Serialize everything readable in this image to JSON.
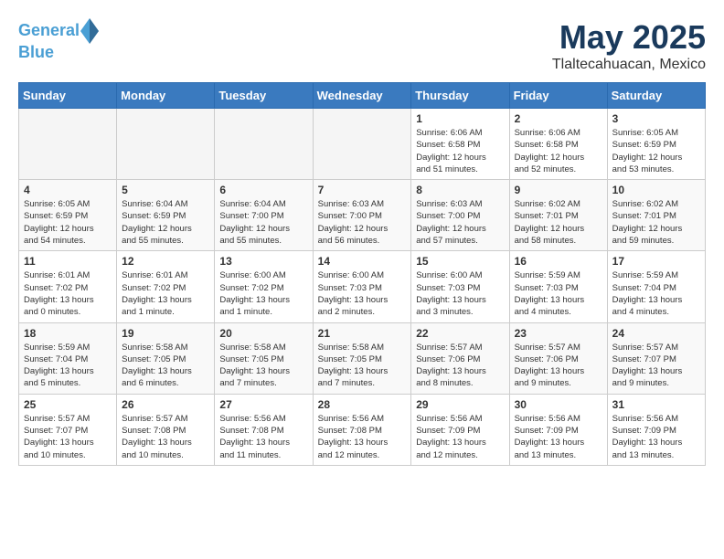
{
  "header": {
    "logo_line1": "General",
    "logo_line2": "Blue",
    "month": "May 2025",
    "location": "Tlaltecahuacan, Mexico"
  },
  "weekdays": [
    "Sunday",
    "Monday",
    "Tuesday",
    "Wednesday",
    "Thursday",
    "Friday",
    "Saturday"
  ],
  "weeks": [
    [
      {
        "day": "",
        "info": ""
      },
      {
        "day": "",
        "info": ""
      },
      {
        "day": "",
        "info": ""
      },
      {
        "day": "",
        "info": ""
      },
      {
        "day": "1",
        "info": "Sunrise: 6:06 AM\nSunset: 6:58 PM\nDaylight: 12 hours\nand 51 minutes."
      },
      {
        "day": "2",
        "info": "Sunrise: 6:06 AM\nSunset: 6:58 PM\nDaylight: 12 hours\nand 52 minutes."
      },
      {
        "day": "3",
        "info": "Sunrise: 6:05 AM\nSunset: 6:59 PM\nDaylight: 12 hours\nand 53 minutes."
      }
    ],
    [
      {
        "day": "4",
        "info": "Sunrise: 6:05 AM\nSunset: 6:59 PM\nDaylight: 12 hours\nand 54 minutes."
      },
      {
        "day": "5",
        "info": "Sunrise: 6:04 AM\nSunset: 6:59 PM\nDaylight: 12 hours\nand 55 minutes."
      },
      {
        "day": "6",
        "info": "Sunrise: 6:04 AM\nSunset: 7:00 PM\nDaylight: 12 hours\nand 55 minutes."
      },
      {
        "day": "7",
        "info": "Sunrise: 6:03 AM\nSunset: 7:00 PM\nDaylight: 12 hours\nand 56 minutes."
      },
      {
        "day": "8",
        "info": "Sunrise: 6:03 AM\nSunset: 7:00 PM\nDaylight: 12 hours\nand 57 minutes."
      },
      {
        "day": "9",
        "info": "Sunrise: 6:02 AM\nSunset: 7:01 PM\nDaylight: 12 hours\nand 58 minutes."
      },
      {
        "day": "10",
        "info": "Sunrise: 6:02 AM\nSunset: 7:01 PM\nDaylight: 12 hours\nand 59 minutes."
      }
    ],
    [
      {
        "day": "11",
        "info": "Sunrise: 6:01 AM\nSunset: 7:02 PM\nDaylight: 13 hours\nand 0 minutes."
      },
      {
        "day": "12",
        "info": "Sunrise: 6:01 AM\nSunset: 7:02 PM\nDaylight: 13 hours\nand 1 minute."
      },
      {
        "day": "13",
        "info": "Sunrise: 6:00 AM\nSunset: 7:02 PM\nDaylight: 13 hours\nand 1 minute."
      },
      {
        "day": "14",
        "info": "Sunrise: 6:00 AM\nSunset: 7:03 PM\nDaylight: 13 hours\nand 2 minutes."
      },
      {
        "day": "15",
        "info": "Sunrise: 6:00 AM\nSunset: 7:03 PM\nDaylight: 13 hours\nand 3 minutes."
      },
      {
        "day": "16",
        "info": "Sunrise: 5:59 AM\nSunset: 7:03 PM\nDaylight: 13 hours\nand 4 minutes."
      },
      {
        "day": "17",
        "info": "Sunrise: 5:59 AM\nSunset: 7:04 PM\nDaylight: 13 hours\nand 4 minutes."
      }
    ],
    [
      {
        "day": "18",
        "info": "Sunrise: 5:59 AM\nSunset: 7:04 PM\nDaylight: 13 hours\nand 5 minutes."
      },
      {
        "day": "19",
        "info": "Sunrise: 5:58 AM\nSunset: 7:05 PM\nDaylight: 13 hours\nand 6 minutes."
      },
      {
        "day": "20",
        "info": "Sunrise: 5:58 AM\nSunset: 7:05 PM\nDaylight: 13 hours\nand 7 minutes."
      },
      {
        "day": "21",
        "info": "Sunrise: 5:58 AM\nSunset: 7:05 PM\nDaylight: 13 hours\nand 7 minutes."
      },
      {
        "day": "22",
        "info": "Sunrise: 5:57 AM\nSunset: 7:06 PM\nDaylight: 13 hours\nand 8 minutes."
      },
      {
        "day": "23",
        "info": "Sunrise: 5:57 AM\nSunset: 7:06 PM\nDaylight: 13 hours\nand 9 minutes."
      },
      {
        "day": "24",
        "info": "Sunrise: 5:57 AM\nSunset: 7:07 PM\nDaylight: 13 hours\nand 9 minutes."
      }
    ],
    [
      {
        "day": "25",
        "info": "Sunrise: 5:57 AM\nSunset: 7:07 PM\nDaylight: 13 hours\nand 10 minutes."
      },
      {
        "day": "26",
        "info": "Sunrise: 5:57 AM\nSunset: 7:08 PM\nDaylight: 13 hours\nand 10 minutes."
      },
      {
        "day": "27",
        "info": "Sunrise: 5:56 AM\nSunset: 7:08 PM\nDaylight: 13 hours\nand 11 minutes."
      },
      {
        "day": "28",
        "info": "Sunrise: 5:56 AM\nSunset: 7:08 PM\nDaylight: 13 hours\nand 12 minutes."
      },
      {
        "day": "29",
        "info": "Sunrise: 5:56 AM\nSunset: 7:09 PM\nDaylight: 13 hours\nand 12 minutes."
      },
      {
        "day": "30",
        "info": "Sunrise: 5:56 AM\nSunset: 7:09 PM\nDaylight: 13 hours\nand 13 minutes."
      },
      {
        "day": "31",
        "info": "Sunrise: 5:56 AM\nSunset: 7:09 PM\nDaylight: 13 hours\nand 13 minutes."
      }
    ]
  ]
}
